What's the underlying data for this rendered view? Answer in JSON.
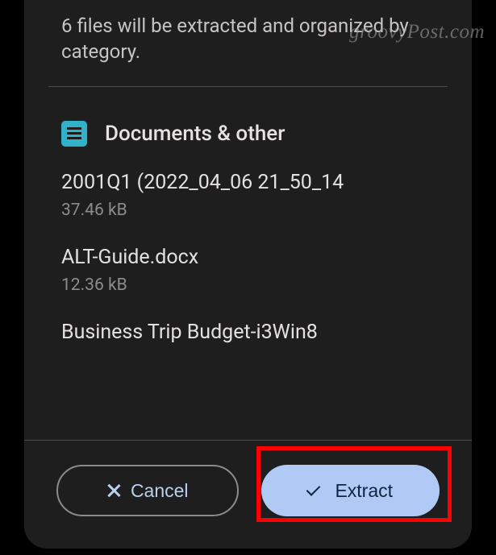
{
  "dialog": {
    "description": "6 files will be extracted and organized by category."
  },
  "section": {
    "title": "Documents & other"
  },
  "files": [
    {
      "name": "2001Q1 (2022_04_06 21_50_14",
      "size": "37.46 kB"
    },
    {
      "name": "ALT-Guide.docx",
      "size": "12.36 kB"
    },
    {
      "name": "Business Trip Budget-i3Win8",
      "size": ""
    }
  ],
  "buttons": {
    "cancel": "Cancel",
    "extract": "Extract"
  },
  "watermark": "groovyPost.com"
}
